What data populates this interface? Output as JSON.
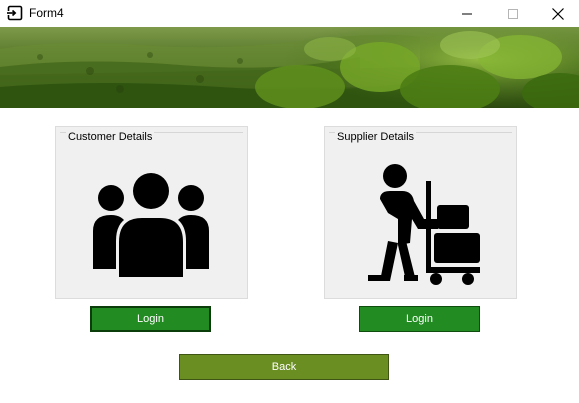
{
  "window": {
    "title": "Form4",
    "icon": "form-app-icon",
    "controls": [
      "minimize-icon",
      "maximize-icon",
      "close-icon"
    ]
  },
  "banner": {
    "image": "tea-plantation-photo"
  },
  "customer": {
    "group_title": "Customer Details",
    "icon": "people-group-icon",
    "login_label": "Login"
  },
  "supplier": {
    "group_title": "Supplier Details",
    "icon": "delivery-worker-trolley-icon",
    "login_label": "Login"
  },
  "back_label": "Back",
  "colors": {
    "login_button": "#228B22",
    "back_button": "#6B8E23",
    "groupbox_bg": "#F0F0F0",
    "icon": "#000000"
  }
}
